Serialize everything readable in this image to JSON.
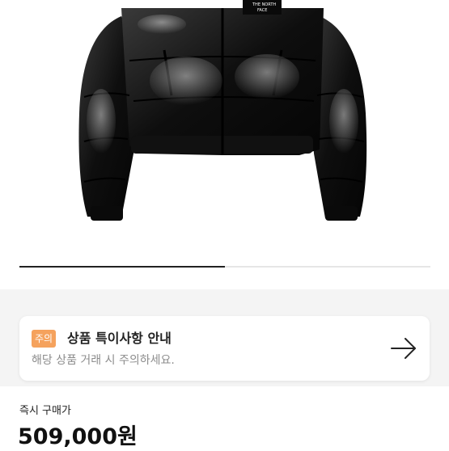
{
  "product": {
    "image_alt": "black puffer jacket",
    "brand_logo_text": "THE NORTH FACE"
  },
  "gallery": {
    "progress_fraction": 0.5
  },
  "notice": {
    "badge": "주의",
    "title": "상품 특이사항 안내",
    "description": "해당 상품 거래 시 주의하세요.",
    "arrow_icon": "arrow-right-icon"
  },
  "price": {
    "label": "즉시 구매가",
    "value": "509,000원"
  },
  "colors": {
    "badge": "#f5a25d",
    "text": "#222222",
    "muted": "#8c8c8c",
    "band": "#f4f4f4"
  }
}
